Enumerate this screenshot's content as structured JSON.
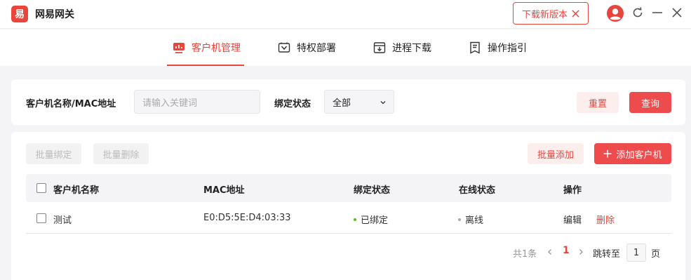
{
  "app": {
    "logo_char": "易",
    "title": "网易网关",
    "update_label": "下载新版本"
  },
  "nav": {
    "items": [
      {
        "label": "客户机管理",
        "icon": "monitor-chart-icon",
        "active": true
      },
      {
        "label": "特权部署",
        "icon": "shield-box-icon",
        "active": false
      },
      {
        "label": "进程下载",
        "icon": "download-box-icon",
        "active": false
      },
      {
        "label": "操作指引",
        "icon": "guide-doc-icon",
        "active": false
      }
    ]
  },
  "filter": {
    "name_label": "客户机名称/MAC地址",
    "name_placeholder": "请输入关键词",
    "status_label": "绑定状态",
    "status_value": "全部",
    "reset_label": "重置",
    "search_label": "查询"
  },
  "toolbar": {
    "bulk_bind": "批量绑定",
    "bulk_delete": "批量删除",
    "bulk_add": "批量添加",
    "add_client": "添加客户机"
  },
  "table": {
    "headers": [
      "客户机名称",
      "MAC地址",
      "绑定状态",
      "在线状态",
      "操作"
    ],
    "rows": [
      {
        "name": "测试",
        "mac": "E0:D5:5E:D4:03:33",
        "bind_status": "已绑定",
        "online_status": "离线",
        "edit": "编辑",
        "delete": "删除"
      }
    ]
  },
  "pagination": {
    "total": "共1条",
    "current_page": "1",
    "jump_label": "跳转至",
    "jump_value": "1",
    "page_suffix": "页"
  },
  "colors": {
    "accent": "#e8453c",
    "bound_dot": "#52c41a",
    "offline_dot": "#aaaaaa"
  }
}
